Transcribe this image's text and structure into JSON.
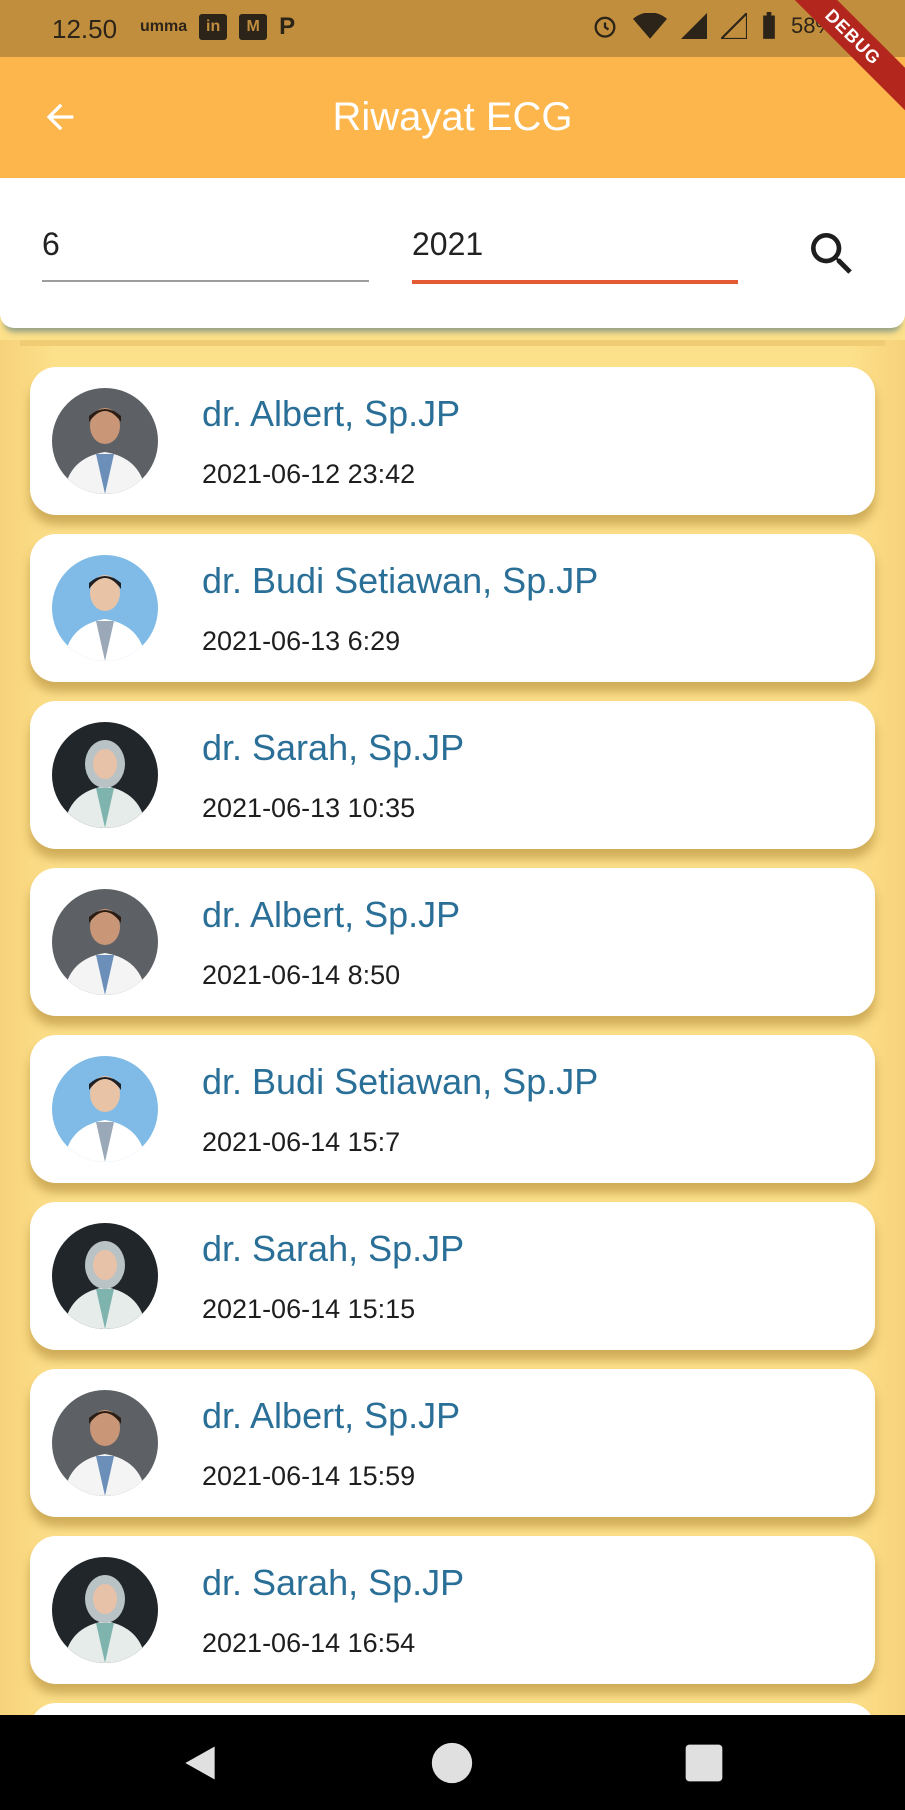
{
  "status_bar": {
    "time": "12.50",
    "left_icons": [
      "umma",
      "in",
      "M",
      "P"
    ],
    "battery": "58%"
  },
  "debug_banner": "DEBUG",
  "app_bar": {
    "title": "Riwayat ECG"
  },
  "filter": {
    "month": "6",
    "year": "2021"
  },
  "history": [
    {
      "name": "dr. Albert, Sp.JP",
      "datetime": "2021-06-12 23:42",
      "avatar": "male-doctor-dark-bg"
    },
    {
      "name": "dr. Budi Setiawan, Sp.JP",
      "datetime": "2021-06-13 6:29",
      "avatar": "male-doctor-blue-bg"
    },
    {
      "name": "dr. Sarah, Sp.JP",
      "datetime": "2021-06-13 10:35",
      "avatar": "female-doctor-hijab"
    },
    {
      "name": "dr. Albert, Sp.JP",
      "datetime": "2021-06-14 8:50",
      "avatar": "male-doctor-dark-bg"
    },
    {
      "name": "dr. Budi Setiawan, Sp.JP",
      "datetime": "2021-06-14 15:7",
      "avatar": "male-doctor-blue-bg"
    },
    {
      "name": "dr. Sarah, Sp.JP",
      "datetime": "2021-06-14 15:15",
      "avatar": "female-doctor-hijab"
    },
    {
      "name": "dr. Albert, Sp.JP",
      "datetime": "2021-06-14 15:59",
      "avatar": "male-doctor-dark-bg"
    },
    {
      "name": "dr. Sarah, Sp.JP",
      "datetime": "2021-06-14 16:54",
      "avatar": "female-doctor-hijab"
    }
  ],
  "colors": {
    "app_bar": "#fdb64c",
    "background": "#fde08a",
    "doctor_name": "#2a6f97",
    "active_underline": "#e35a35"
  }
}
